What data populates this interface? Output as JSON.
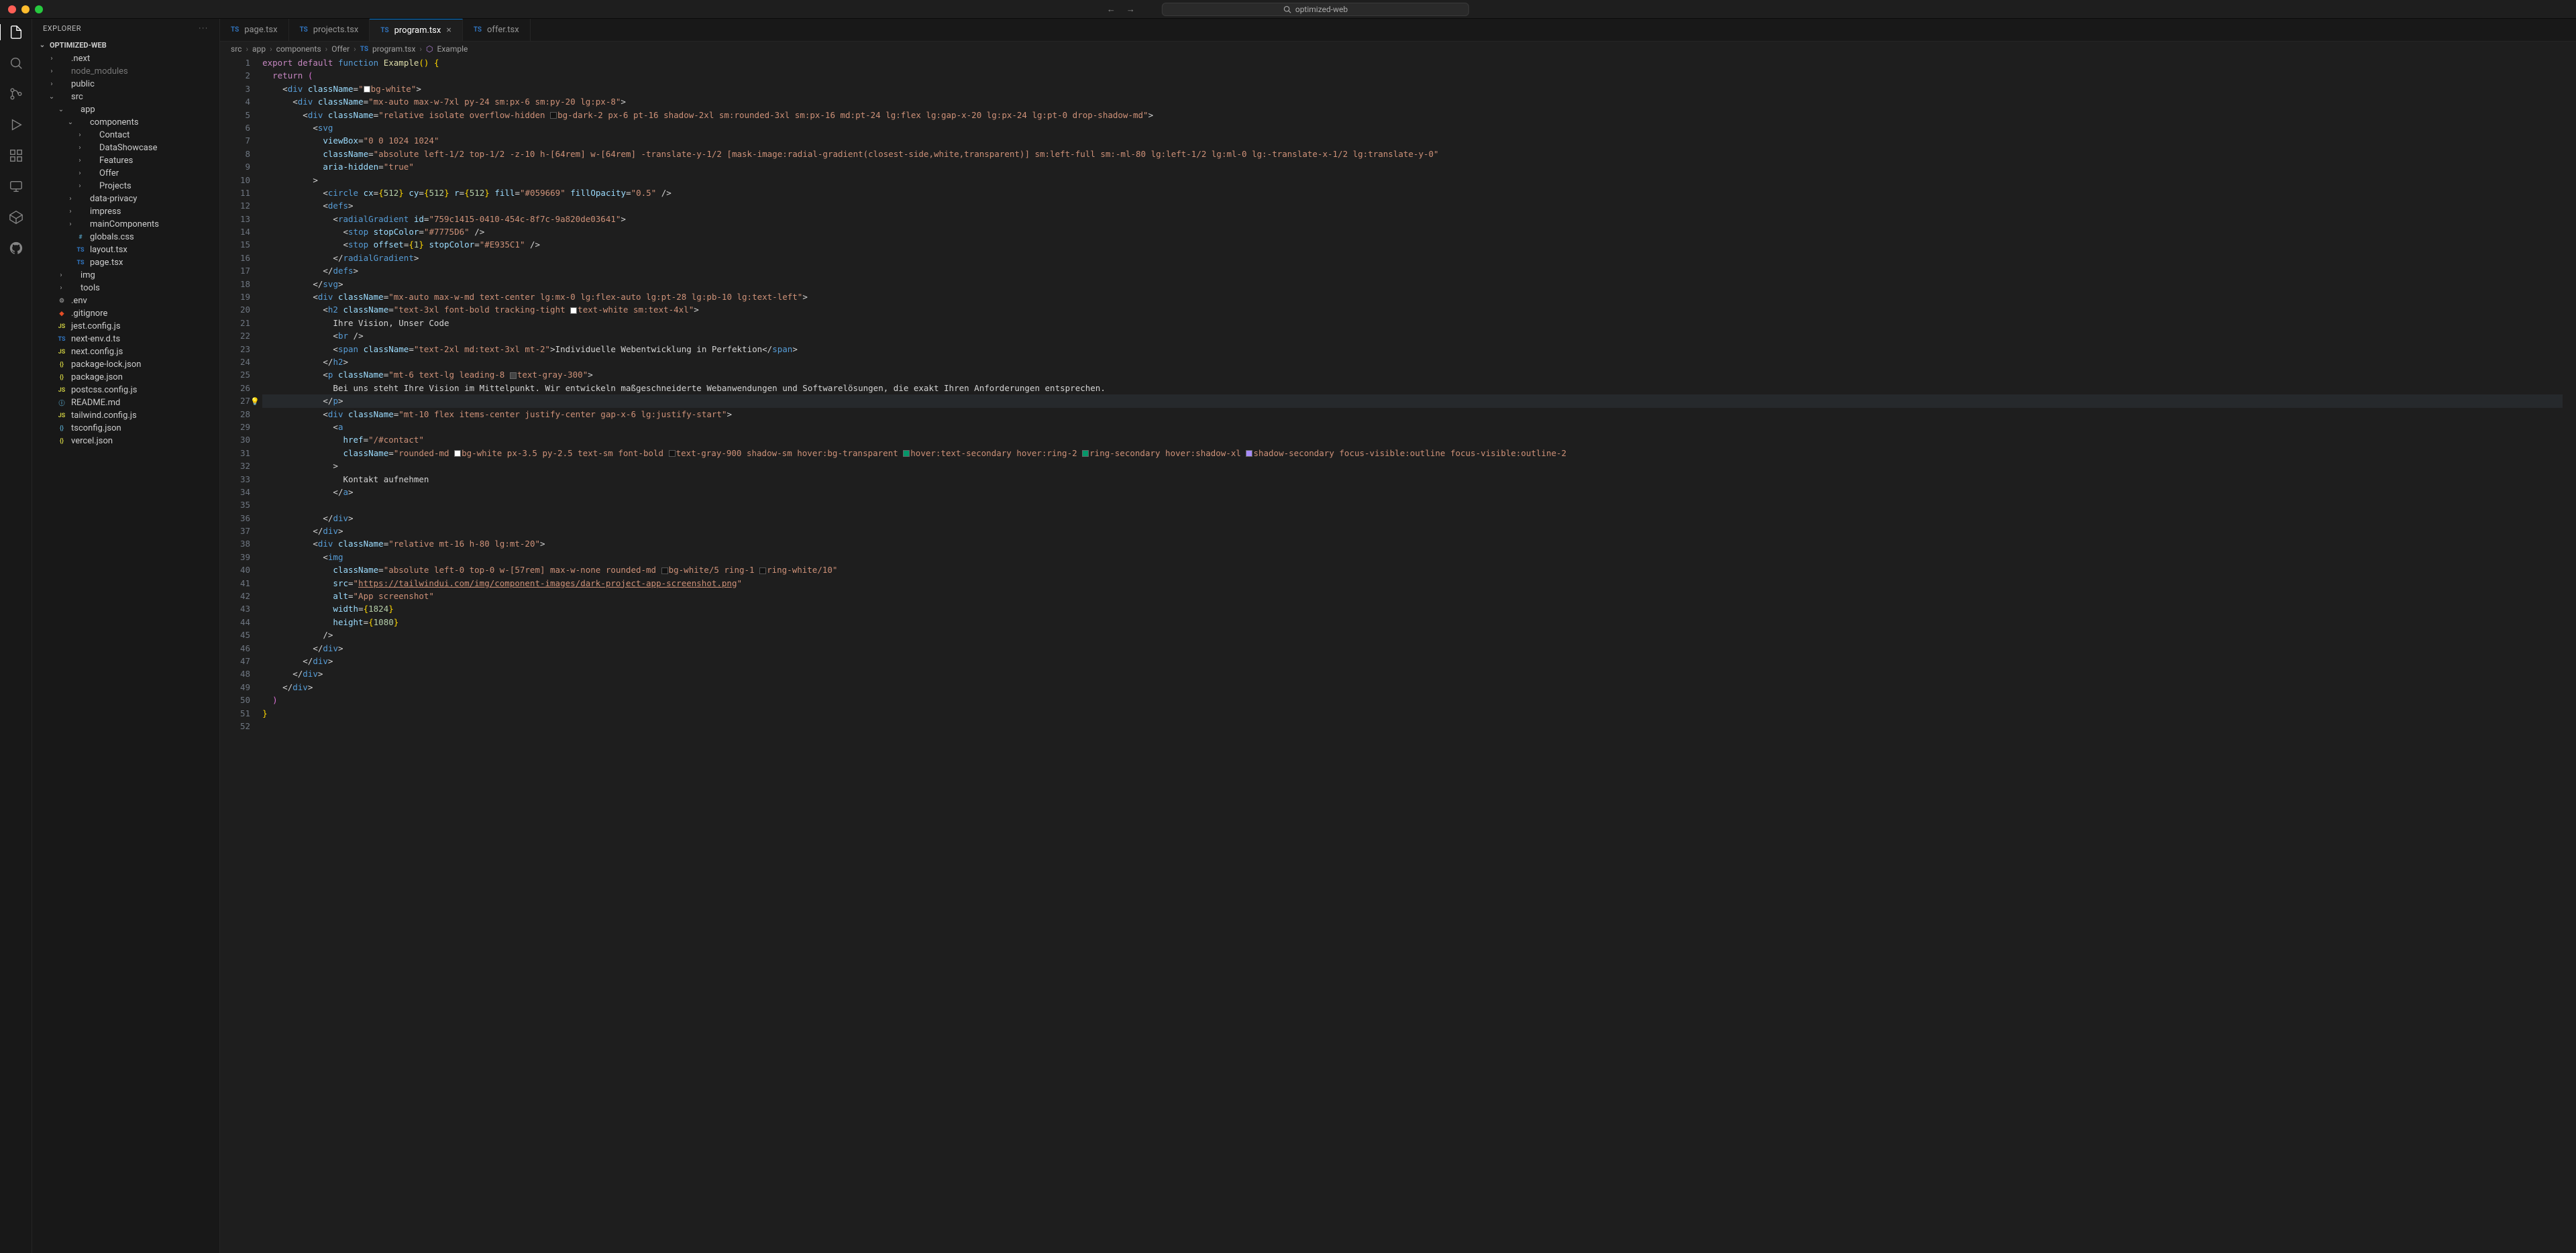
{
  "titlebar": {
    "project": "optimized-web"
  },
  "sidebar": {
    "title": "EXPLORER",
    "project": "OPTIMIZED-WEB",
    "tree": [
      {
        "d": 1,
        "chev": "›",
        "ico": "",
        "label": ".next"
      },
      {
        "d": 1,
        "chev": "›",
        "ico": "",
        "label": "node_modules",
        "dim": true
      },
      {
        "d": 1,
        "chev": "›",
        "ico": "",
        "label": "public"
      },
      {
        "d": 1,
        "chev": "⌄",
        "ico": "",
        "label": "src"
      },
      {
        "d": 2,
        "chev": "⌄",
        "ico": "",
        "label": "app"
      },
      {
        "d": 3,
        "chev": "⌄",
        "ico": "",
        "label": "components"
      },
      {
        "d": 4,
        "chev": "›",
        "ico": "",
        "label": "Contact"
      },
      {
        "d": 4,
        "chev": "›",
        "ico": "",
        "label": "DataShowcase"
      },
      {
        "d": 4,
        "chev": "›",
        "ico": "",
        "label": "Features"
      },
      {
        "d": 4,
        "chev": "›",
        "ico": "",
        "label": "Offer"
      },
      {
        "d": 4,
        "chev": "›",
        "ico": "",
        "label": "Projects"
      },
      {
        "d": 3,
        "chev": "›",
        "ico": "",
        "label": "data-privacy"
      },
      {
        "d": 3,
        "chev": "›",
        "ico": "",
        "label": "impress"
      },
      {
        "d": 3,
        "chev": "›",
        "ico": "",
        "label": "mainComponents"
      },
      {
        "d": 3,
        "chev": "",
        "ico": "#",
        "label": "globals.css",
        "c": "#519aba"
      },
      {
        "d": 3,
        "chev": "",
        "ico": "TS",
        "label": "layout.tsx",
        "c": "#3178c6"
      },
      {
        "d": 3,
        "chev": "",
        "ico": "TS",
        "label": "page.tsx",
        "c": "#3178c6"
      },
      {
        "d": 2,
        "chev": "›",
        "ico": "",
        "label": "img"
      },
      {
        "d": 2,
        "chev": "›",
        "ico": "",
        "label": "tools"
      },
      {
        "d": 1,
        "chev": "",
        "ico": "⚙",
        "label": ".env",
        "c": "#888"
      },
      {
        "d": 1,
        "chev": "",
        "ico": "◆",
        "label": ".gitignore",
        "c": "#e44d26"
      },
      {
        "d": 1,
        "chev": "",
        "ico": "JS",
        "label": "jest.config.js",
        "c": "#cbcb41"
      },
      {
        "d": 1,
        "chev": "",
        "ico": "TS",
        "label": "next-env.d.ts",
        "c": "#3178c6"
      },
      {
        "d": 1,
        "chev": "",
        "ico": "JS",
        "label": "next.config.js",
        "c": "#cbcb41"
      },
      {
        "d": 1,
        "chev": "",
        "ico": "{}",
        "label": "package-lock.json",
        "c": "#cbcb41"
      },
      {
        "d": 1,
        "chev": "",
        "ico": "{}",
        "label": "package.json",
        "c": "#cbcb41"
      },
      {
        "d": 1,
        "chev": "",
        "ico": "JS",
        "label": "postcss.config.js",
        "c": "#cbcb41"
      },
      {
        "d": 1,
        "chev": "",
        "ico": "ⓘ",
        "label": "README.md",
        "c": "#519aba"
      },
      {
        "d": 1,
        "chev": "",
        "ico": "JS",
        "label": "tailwind.config.js",
        "c": "#cbcb41"
      },
      {
        "d": 1,
        "chev": "",
        "ico": "{}",
        "label": "tsconfig.json",
        "c": "#519aba"
      },
      {
        "d": 1,
        "chev": "",
        "ico": "{}",
        "label": "vercel.json",
        "c": "#cbcb41"
      }
    ]
  },
  "tabs": [
    {
      "label": "page.tsx",
      "active": false
    },
    {
      "label": "projects.tsx",
      "active": false
    },
    {
      "label": "program.tsx",
      "active": true,
      "close": true
    },
    {
      "label": "offer.tsx",
      "active": false
    }
  ],
  "breadcrumb": [
    "src",
    "app",
    "components",
    "Offer",
    "program.tsx",
    "Example"
  ],
  "code": {
    "lineCount": 52,
    "bulbLine": 27,
    "highlightLine": 27
  }
}
